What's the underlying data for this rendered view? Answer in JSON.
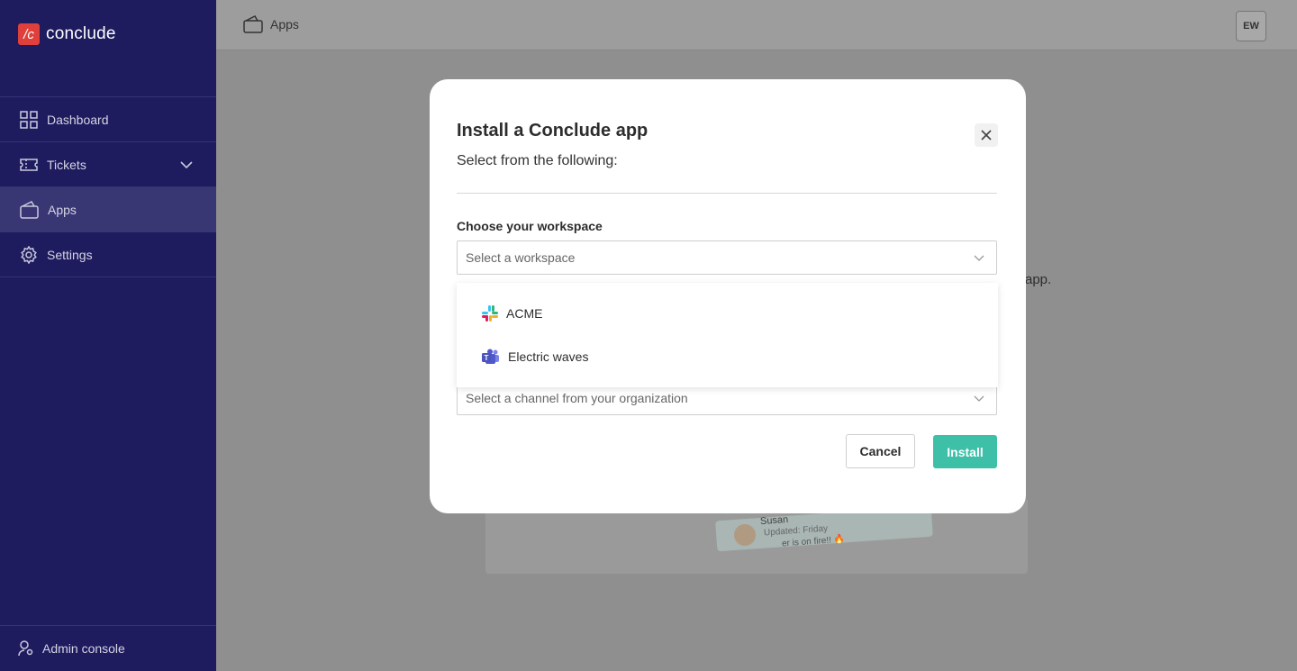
{
  "app": {
    "logo_mark": "/c",
    "name": "conclude"
  },
  "sidebar": {
    "items": [
      {
        "label": "Dashboard",
        "icon": "grid-icon"
      },
      {
        "label": "Tickets",
        "icon": "ticket-icon"
      },
      {
        "label": "Apps",
        "icon": "wallet-icon",
        "active": true
      },
      {
        "label": "Settings",
        "icon": "gear-icon"
      }
    ],
    "admin_label": "Admin console"
  },
  "header": {
    "breadcrumb": "Apps",
    "avatar_initials": "EW"
  },
  "background": {
    "text_fragment": "app.",
    "card": {
      "name": "Susan",
      "updated": "Updated: Friday",
      "note": "er is on fire!! 🔥"
    }
  },
  "modal": {
    "title": "Install a Conclude app",
    "subtitle": "Select from the following:",
    "workspace_label": "Choose your workspace",
    "workspace_placeholder": "Select a workspace",
    "workspace_options": [
      {
        "label": "ACME",
        "icon": "slack-icon"
      },
      {
        "label": "Electric waves",
        "icon": "teams-icon"
      }
    ],
    "channel_placeholder": "Select a channel from your organization",
    "cancel_label": "Cancel",
    "install_label": "Install"
  },
  "colors": {
    "sidebar_bg": "#1e1b5e",
    "sidebar_active": "#393674",
    "brand_red": "#e0403c",
    "install_green": "#3dbfa8"
  }
}
